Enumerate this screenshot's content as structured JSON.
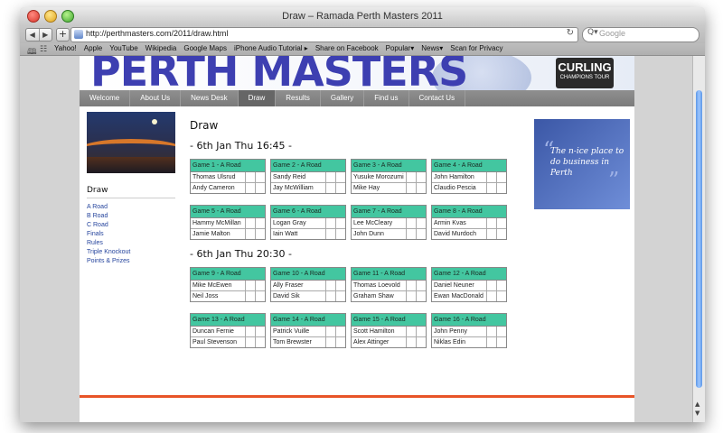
{
  "window": {
    "title": "Draw – Ramada Perth Masters 2011"
  },
  "toolbar": {
    "back": "◀",
    "forward": "▶",
    "add": "+",
    "url": "http://perthmasters.com/2011/draw.html",
    "reload": "↻",
    "search_placeholder": "Google",
    "search_icon": "Q▾"
  },
  "bookmarks": {
    "icons": [
      "book-icon",
      "grid-icon"
    ],
    "items": [
      "Yahoo!",
      "Apple",
      "YouTube",
      "Wikipedia",
      "Google Maps",
      "iPhone Audio Tutorial ▸",
      "Share on Facebook",
      "Popular▾",
      "News▾",
      "Scan for Privacy"
    ]
  },
  "banner": {
    "title": "PERTH MASTERS",
    "curling_title": "CURLING",
    "curling_sub": "CHAMPIONS TOUR"
  },
  "menu": {
    "items": [
      "Welcome",
      "About Us",
      "News Desk",
      "Draw",
      "Results",
      "Gallery",
      "Find us",
      "Contact Us"
    ],
    "active": "Draw"
  },
  "sidebar": {
    "title": "Draw",
    "links": [
      "A Road",
      "B Road",
      "C Road",
      "Finals",
      "Rules",
      "Triple Knockout",
      "Points & Prizes"
    ]
  },
  "main": {
    "title": "Draw",
    "sessions": [
      {
        "title": "- 6th Jan Thu 16:45 -",
        "games": [
          {
            "label": "Game 1 - A Road",
            "teams": [
              "Thomas Ulsrud",
              "Andy Cameron"
            ]
          },
          {
            "label": "Game 2 - A Road",
            "teams": [
              "Sandy Reid",
              "Jay McWilliam"
            ]
          },
          {
            "label": "Game 3 - A Road",
            "teams": [
              "Yusuke Morozumi",
              "Mike Hay"
            ]
          },
          {
            "label": "Game 4 - A Road",
            "teams": [
              "John Hamilton",
              "Claudio Pescia"
            ]
          },
          {
            "label": "Game 5 - A Road",
            "teams": [
              "Hammy McMillan",
              "Jamie Malton"
            ]
          },
          {
            "label": "Game 6 - A Road",
            "teams": [
              "Logan Gray",
              "Iain Watt"
            ]
          },
          {
            "label": "Game 7 - A Road",
            "teams": [
              "Lee McCleary",
              "John Dunn"
            ]
          },
          {
            "label": "Game 8 - A Road",
            "teams": [
              "Armin Kvas",
              "David Murdoch"
            ]
          }
        ]
      },
      {
        "title": "- 6th Jan Thu 20:30 -",
        "games": [
          {
            "label": "Game 9 - A Road",
            "teams": [
              "Mike McEwen",
              "Neil Joss"
            ]
          },
          {
            "label": "Game 10 - A Road",
            "teams": [
              "Ally Fraser",
              "David Sik"
            ]
          },
          {
            "label": "Game 11 - A Road",
            "teams": [
              "Thomas Loevold",
              "Graham Shaw"
            ]
          },
          {
            "label": "Game 12 - A Road",
            "teams": [
              "Daniel Neuner",
              "Ewan MacDonald"
            ]
          },
          {
            "label": "Game 13 - A Road",
            "teams": [
              "Duncan Fernie",
              "Paul Stevenson"
            ]
          },
          {
            "label": "Game 14 - A Road",
            "teams": [
              "Patrick Vuille",
              "Tom Brewster"
            ]
          },
          {
            "label": "Game 15 - A Road",
            "teams": [
              "Scott Hamilton",
              "Alex Attinger"
            ]
          },
          {
            "label": "Game 16 - A Road",
            "teams": [
              "John Penny",
              "Niklas Edin"
            ]
          }
        ]
      }
    ]
  },
  "ad": {
    "open_quote": "“",
    "text": "The n-ice place to do business in Perth",
    "close_quote": "”"
  },
  "scroll": {
    "up": "▲",
    "down": "▼"
  },
  "colors": {
    "game_header": "#43c6a0",
    "menu_bg": "#888888",
    "link": "#25449d",
    "footer_line": "#e85427",
    "ad_bg": "#4d6bbb",
    "banner_title": "#3d3fb1"
  }
}
